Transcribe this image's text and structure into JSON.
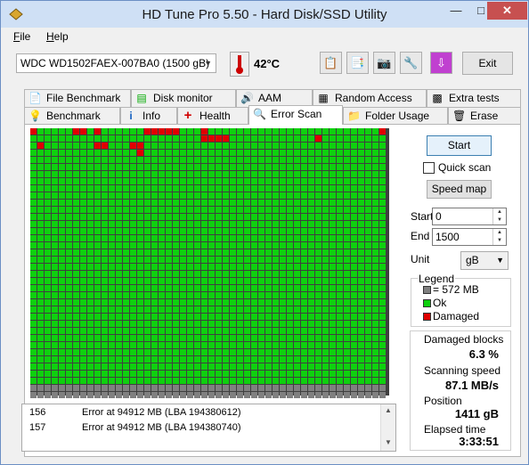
{
  "window": {
    "title": "HD Tune Pro 5.50 - Hard Disk/SSD Utility",
    "minimize": "—",
    "maximize": "□",
    "close": "✕"
  },
  "menu": [
    {
      "label": "File",
      "accel": "F",
      "rest": "ile"
    },
    {
      "label": "Help",
      "accel": "H",
      "rest": "elp"
    }
  ],
  "toolbar": {
    "drive": "WDC WD1502FAEX-007BA0 (1500 gB)",
    "temperature": "42°C",
    "exit_label": "Exit",
    "icons": [
      "copy-info-icon",
      "copy-screen-icon",
      "screenshot-icon",
      "options-icon",
      "download-icon"
    ]
  },
  "tabs_top": [
    {
      "label": "File Benchmark",
      "icon": "file-benchmark-icon"
    },
    {
      "label": "Disk monitor",
      "icon": "disk-monitor-icon"
    },
    {
      "label": "AAM",
      "icon": "aam-icon"
    },
    {
      "label": "Random Access",
      "icon": "random-access-icon"
    },
    {
      "label": "Extra tests",
      "icon": "extra-tests-icon"
    }
  ],
  "tabs_bottom": [
    {
      "label": "Benchmark",
      "icon": "benchmark-icon"
    },
    {
      "label": "Info",
      "icon": "info-icon"
    },
    {
      "label": "Health",
      "icon": "health-icon"
    },
    {
      "label": "Error Scan",
      "icon": "error-scan-icon",
      "active": true
    },
    {
      "label": "Folder Usage",
      "icon": "folder-usage-icon"
    },
    {
      "label": "Erase",
      "icon": "erase-icon"
    }
  ],
  "scan_map": {
    "columns": 50,
    "rows": 38,
    "ok_rows": 36,
    "damaged_cells": [
      [
        0,
        0
      ],
      [
        0,
        6
      ],
      [
        0,
        7
      ],
      [
        0,
        9
      ],
      [
        0,
        16
      ],
      [
        0,
        17
      ],
      [
        0,
        18
      ],
      [
        0,
        19
      ],
      [
        0,
        20
      ],
      [
        0,
        24
      ],
      [
        0,
        49
      ],
      [
        1,
        24
      ],
      [
        1,
        25
      ],
      [
        1,
        26
      ],
      [
        1,
        27
      ],
      [
        1,
        40
      ],
      [
        2,
        1
      ],
      [
        2,
        9
      ],
      [
        2,
        10
      ],
      [
        2,
        14
      ],
      [
        2,
        14
      ],
      [
        2,
        15
      ],
      [
        3,
        15
      ]
    ],
    "colors": {
      "ok": "#0fd00f",
      "damaged": "#e00000",
      "unused": "#808080"
    }
  },
  "log": [
    {
      "num": "156",
      "text": "Error at 94912 MB (LBA 194380612)"
    },
    {
      "num": "157",
      "text": "Error at 94912 MB (LBA 194380740)"
    }
  ],
  "controls": {
    "start_label": "Start",
    "quick_scan_label": "Quick scan",
    "quick_scan_checked": false,
    "speed_map_label": "Speed map",
    "start_field_label": "Start",
    "start_value": "0",
    "end_field_label": "End",
    "end_value": "1500",
    "unit_label": "Unit",
    "unit_value": "gB"
  },
  "legend": {
    "title": "Legend",
    "items": [
      {
        "label": "= 572 MB",
        "color": "#808080"
      },
      {
        "label": "Ok",
        "color": "#0fd00f"
      },
      {
        "label": "Damaged",
        "color": "#e00000"
      }
    ]
  },
  "stats": {
    "damaged_label": "Damaged blocks",
    "damaged_value": "6.3 %",
    "speed_label": "Scanning speed",
    "speed_value": "87.1 MB/s",
    "position_label": "Position",
    "position_value": "1411 gB",
    "elapsed_label": "Elapsed time",
    "elapsed_value": "3:33:51"
  }
}
